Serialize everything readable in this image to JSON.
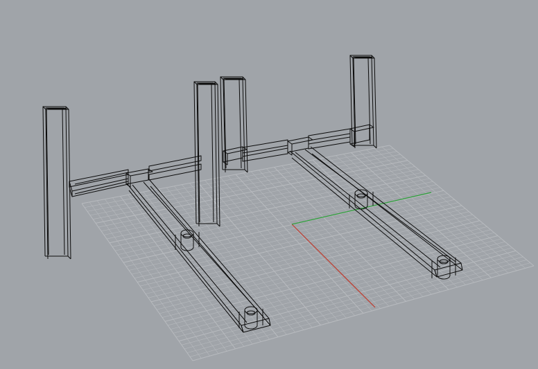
{
  "viewport": {
    "view": "perspective",
    "display_mode": "wireframe",
    "background_color": "#a0a4a9",
    "grid_color": "#8e9297",
    "grid_line_color": "#b4b7bb",
    "x_axis_color": "#c0392b",
    "y_axis_color": "#2e9e3a",
    "wire_color": "#000000"
  }
}
